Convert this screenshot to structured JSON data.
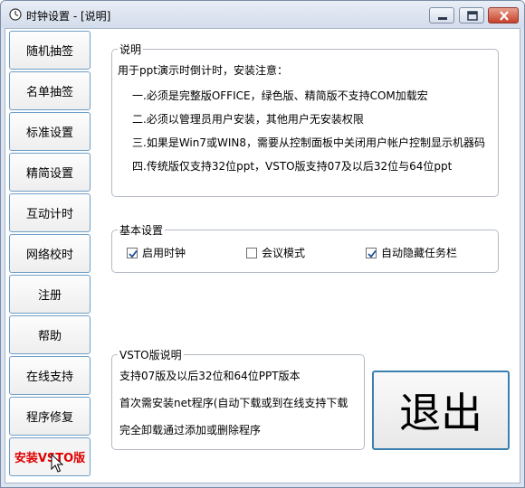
{
  "window": {
    "title": "时钟设置 - [说明]"
  },
  "sidebar": {
    "items": [
      {
        "label": "随机抽签"
      },
      {
        "label": "名单抽签"
      },
      {
        "label": "标准设置"
      },
      {
        "label": "精简设置"
      },
      {
        "label": "互动计时"
      },
      {
        "label": "网络校时"
      },
      {
        "label": "注册"
      },
      {
        "label": "帮助"
      },
      {
        "label": "在线支持"
      },
      {
        "label": "程序修复"
      },
      {
        "label": "安装VSTO版"
      }
    ],
    "active_index": 10,
    "active_color": "#e00000"
  },
  "instructions": {
    "title": "说明",
    "intro": "用于ppt演示时倒计时，安装注意：",
    "items": [
      "一.必须是完整版OFFICE，绿色版、精简版不支持COM加载宏",
      "二.必须以管理员用户安装，其他用户无安装权限",
      "三.如果是Win7或WIN8，需要从控制面板中关闭用户帐户控制显示机器码",
      "四.传统版仅支持32位ppt，VSTO版支持07及以后32位与64位ppt"
    ]
  },
  "basic_settings": {
    "title": "基本设置",
    "options": [
      {
        "label": "启用时钟",
        "checked": true
      },
      {
        "label": "会议模式",
        "checked": false
      },
      {
        "label": "自动隐藏任务栏",
        "checked": true
      }
    ]
  },
  "vsto": {
    "title": "VSTO版说明",
    "lines": [
      "支持07版及以后32位和64位PPT版本",
      "首次需安装net程序(自动下载或到在线支持下载",
      "完全卸载通过添加或删除程序"
    ]
  },
  "exit_button": {
    "label": "退出"
  },
  "colors": {
    "titlebar": "#d3dceb",
    "sidebar_border": "#6e9ec6",
    "exit_border": "#3c7fb1"
  }
}
